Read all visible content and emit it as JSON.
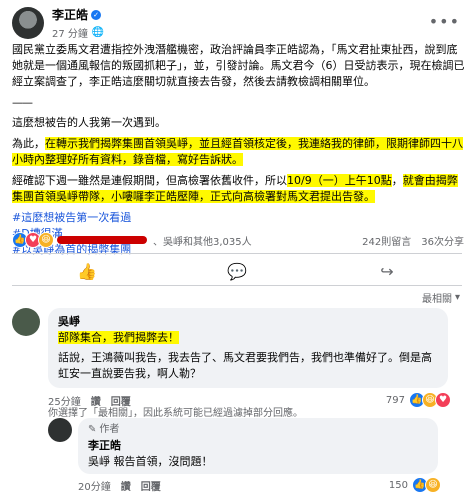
{
  "post": {
    "author": "李正皓",
    "time": "27 分鐘",
    "privacy_icon": "globe-icon",
    "paragraphs": {
      "p1": "國民黨立委馬文君遭指控外洩潛艦機密，政治評論員李正皓認為，「馬文君扯東扯西，說到底她就是一個通風報信的叛國抓耙子」，並，引發討論。馬文君今（6）日受訪表示，現在檢調已經立案調查了，李正皓這麼關切就直接去告發，然後去請教檢調相關單位。",
      "separator": "——",
      "p2": "這麼想被告的人我第一次遇到。",
      "p3_a": "為此，",
      "p3_b": "在轉示我們揭弊集團首領吳崢，並且經首領核定後，",
      "p3_c": "我連絡我的律師，限期律師四十八小時內整理好所有資料，錄音檔，寫好告訴狀。",
      "p4_a": "經確認下週一雖然是連假期間，但高檢署依舊收件，所以",
      "p4_b": "10/9（一）上午10點",
      "p4_c": "，",
      "p4_d": "就會由揭弊集團首領吳崢帶隊，小嘍囉李正皓壓陣，正式向高檢署對馬文君提出告發。"
    },
    "hashtags": [
      "#這麼想被告第一次看過",
      "#D槽很滿",
      "#以吳崢為首的揭弊集團"
    ]
  },
  "reactions": {
    "summary": "、吳崢和其他3,035人",
    "comments_count": "242則留言",
    "shares_count": "36次分享"
  },
  "actions": {
    "like_icon": "thumbs-up-icon",
    "comment_icon": "comment-bubble-icon",
    "share_icon": "share-arrow-icon"
  },
  "sort_label": "最相關",
  "comments": [
    {
      "author": "吳崢",
      "highlight": "部隊集合，我們揭弊去！",
      "body": "話說，王鴻薇叫我告，我去告了、馬文君要我們告，我們也準備好了。倒是高虹安一直說要告我，啊人勒？",
      "time": "25分鐘",
      "like": "讚",
      "reply": "回覆",
      "count": "797"
    }
  ],
  "filter_note": "你選擇了「最相關」，因此系統可能已經過濾掉部分回應。",
  "reply": {
    "author_tag": "作者",
    "author": "李正皓",
    "body": "吳崢 報告首領，沒問題！",
    "time": "20分鐘",
    "like": "讚",
    "reply": "回覆",
    "count": "150"
  }
}
